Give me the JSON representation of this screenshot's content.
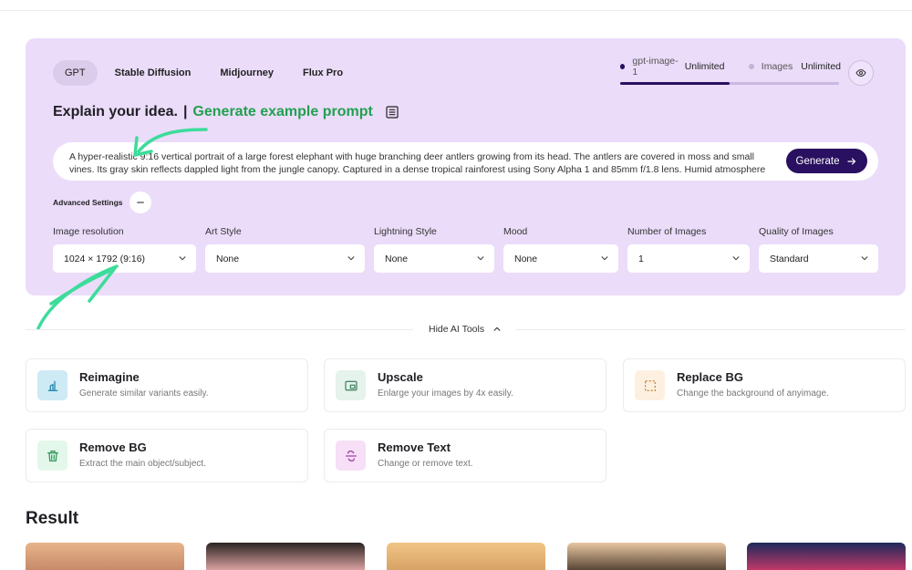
{
  "tabs": [
    {
      "label": "GPT",
      "active": true
    },
    {
      "label": "Stable Diffusion",
      "active": false
    },
    {
      "label": "Midjourney",
      "active": false
    },
    {
      "label": "Flux Pro",
      "active": false
    }
  ],
  "usage": {
    "model_name": "gpt-image-1",
    "model_quota": "Unlimited",
    "images_name": "Images",
    "images_quota": "Unlimited",
    "progress_fraction": 0.5
  },
  "headline": {
    "title": "Explain your idea.",
    "separator": "|",
    "example_link": "Generate example prompt"
  },
  "prompt": {
    "value": "A hyper-realistic 9:16 vertical portrait of a large forest elephant with huge branching deer antlers growing from its head. The antlers are covered in moss and small vines. Its gray skin reflects dappled light from the jungle canopy. Captured in a dense tropical rainforest using Sony Alpha 1 and 85mm f/1.8 lens. Humid atmosphere with light rays cutting through"
  },
  "generate_label": "Generate",
  "advanced_settings_label": "Advanced Settings",
  "settings": [
    {
      "label": "Image resolution",
      "value": "1024 × 1792 (9:16)"
    },
    {
      "label": "Art Style",
      "value": "None"
    },
    {
      "label": "Lightning Style",
      "value": "None"
    },
    {
      "label": "Mood",
      "value": "None"
    },
    {
      "label": "Number of Images",
      "value": "1"
    },
    {
      "label": "Quality of Images",
      "value": "Standard"
    }
  ],
  "hide_tools_label": "Hide AI Tools",
  "tools": [
    {
      "title": "Reimagine",
      "desc": "Generate similar variants easily.",
      "icon": "reimagine-icon",
      "bg": "#cdeaf5"
    },
    {
      "title": "Upscale",
      "desc": "Enlarge your images by 4x easily.",
      "icon": "upscale-icon",
      "bg": "#e6f2ec"
    },
    {
      "title": "Replace BG",
      "desc": "Change the background of anyimage.",
      "icon": "replace-bg-icon",
      "bg": "#fdf0e1"
    },
    {
      "title": "Remove BG",
      "desc": "Extract the main object/subject.",
      "icon": "trash-icon",
      "bg": "#e3f7ea"
    },
    {
      "title": "Remove Text",
      "desc": "Change or remove text.",
      "icon": "strikethrough-icon",
      "bg": "#f7dff7"
    }
  ],
  "result_title": "Result",
  "colors": {
    "panel_bg": "#ebdcfa",
    "primary": "#2a1060",
    "accent_green": "#22a04f",
    "annotation_arrow": "#3ddc9a"
  }
}
